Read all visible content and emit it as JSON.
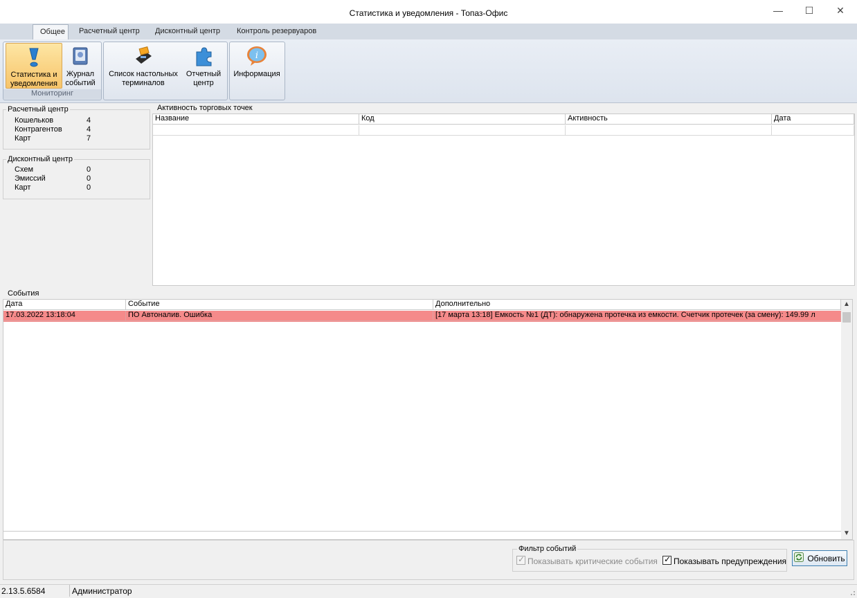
{
  "window": {
    "title": "Статистика и уведомления - Топаз-Офис",
    "minimize_glyph": "—",
    "maximize_glyph": "☐",
    "close_glyph": "✕"
  },
  "ribbon": {
    "tabs": [
      {
        "label": "Общее",
        "active": true
      },
      {
        "label": "Расчетный центр",
        "active": false
      },
      {
        "label": "Дисконтный центр",
        "active": false
      },
      {
        "label": "Контроль резервуаров",
        "active": false
      }
    ],
    "groups": [
      {
        "label": "Мониторинг"
      }
    ],
    "buttons": [
      {
        "line1": "Статистика и",
        "line2": "уведомления",
        "icon": "exclamation-icon",
        "selected": true
      },
      {
        "line1": "Журнал",
        "line2": "событий",
        "icon": "journal-icon"
      },
      {
        "line1": "Список настольных",
        "line2": "терминалов",
        "icon": "terminal-icon"
      },
      {
        "line1": "Отчетный",
        "line2": "центр",
        "icon": "puzzle-icon"
      },
      {
        "line1": "Информация",
        "line2": "",
        "icon": "info-icon"
      }
    ]
  },
  "settlement": {
    "legend": "Расчетный центр",
    "rows": [
      {
        "label": "Кошельков",
        "value": "4"
      },
      {
        "label": "Контрагентов",
        "value": "4"
      },
      {
        "label": "Карт",
        "value": "7"
      }
    ]
  },
  "discount": {
    "legend": "Дисконтный центр",
    "rows": [
      {
        "label": "Схем",
        "value": "0"
      },
      {
        "label": "Эмиссий",
        "value": "0"
      },
      {
        "label": "Карт",
        "value": "0"
      }
    ]
  },
  "activity": {
    "legend": "Активность торговых точек",
    "columns": [
      "Название",
      "Код",
      "Активность",
      "Дата"
    ]
  },
  "events": {
    "legend": "События",
    "columns": [
      "Дата",
      "Событие",
      "Дополнительно"
    ],
    "rows": [
      {
        "date": "17.03.2022 13:18:04",
        "event": "ПО Автоналив. Ошибка",
        "details": "[17 марта 13:18] Емкость №1 (ДТ): обнаружена протечка из емкости. Счетчик протечек (за смену): 149.99 л",
        "color": "#f58a8a"
      }
    ]
  },
  "filter": {
    "legend": "Фильтр событий",
    "critical_label": "Показывать критические события",
    "critical_checked": true,
    "critical_disabled": true,
    "warnings_label": "Показывать предупреждения",
    "warnings_checked": true,
    "refresh_label": "Обновить"
  },
  "status": {
    "version": "2.13.5.6584",
    "user": "Администратор"
  }
}
